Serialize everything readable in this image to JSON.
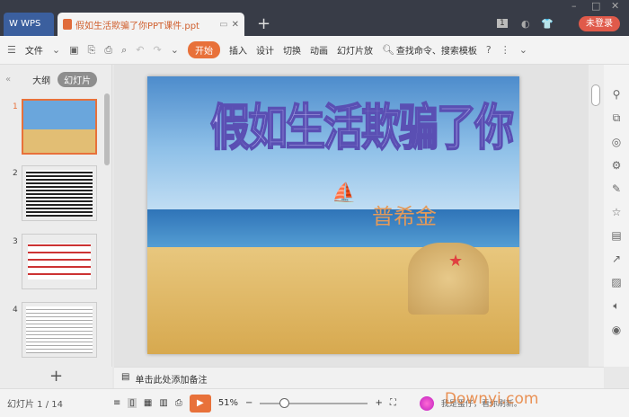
{
  "app": {
    "brand": "WPS",
    "doc_tab": "假如生活欺骗了你PPT课件.ppt",
    "new_tab": "+",
    "badge": "1",
    "login": "未登录"
  },
  "toolbar": {
    "file": "文件",
    "tabs": [
      "开始",
      "插入",
      "设计",
      "切换",
      "动画",
      "幻灯片放"
    ],
    "search": "查找命令、搜索模板",
    "help": "?"
  },
  "left_panel": {
    "tabs": [
      "大纲",
      "幻灯片"
    ],
    "slides": [
      "1",
      "2",
      "3",
      "4"
    ],
    "add": "+"
  },
  "slide": {
    "title": "假如生活欺骗了你",
    "author": "普希金"
  },
  "notes": {
    "placeholder": "单击此处添加备注"
  },
  "status": {
    "slide_counter": "幻灯片 1 / 14",
    "zoom": "51%",
    "zoom_fraction": 0.51,
    "watermark": "Downyi.com",
    "user_text": "我是蛋仔，看你刷新。"
  }
}
